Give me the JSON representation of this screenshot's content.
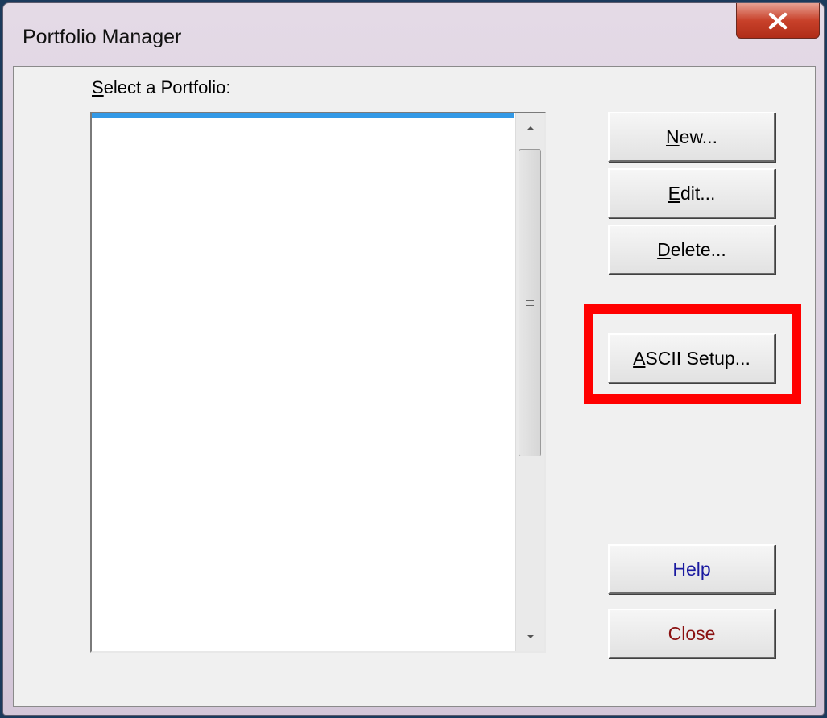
{
  "window": {
    "title": "Portfolio Manager",
    "close_icon": "close-x-icon"
  },
  "list": {
    "label_accel": "S",
    "label_rest": "elect a Portfolio:",
    "items": [],
    "selection_color": "#3399e6"
  },
  "buttons": {
    "new": {
      "accel": "N",
      "rest": "ew..."
    },
    "edit": {
      "accel": "E",
      "rest": "dit..."
    },
    "delete": {
      "accel": "D",
      "rest": "elete..."
    },
    "ascii": {
      "accel": "A",
      "rest": "SCII Setup..."
    },
    "help": {
      "label": "Help"
    },
    "close": {
      "label": "Close"
    }
  },
  "colors": {
    "highlight_box": "#ff0000",
    "help_text": "#1a1aa0",
    "close_text": "#8a1010"
  }
}
